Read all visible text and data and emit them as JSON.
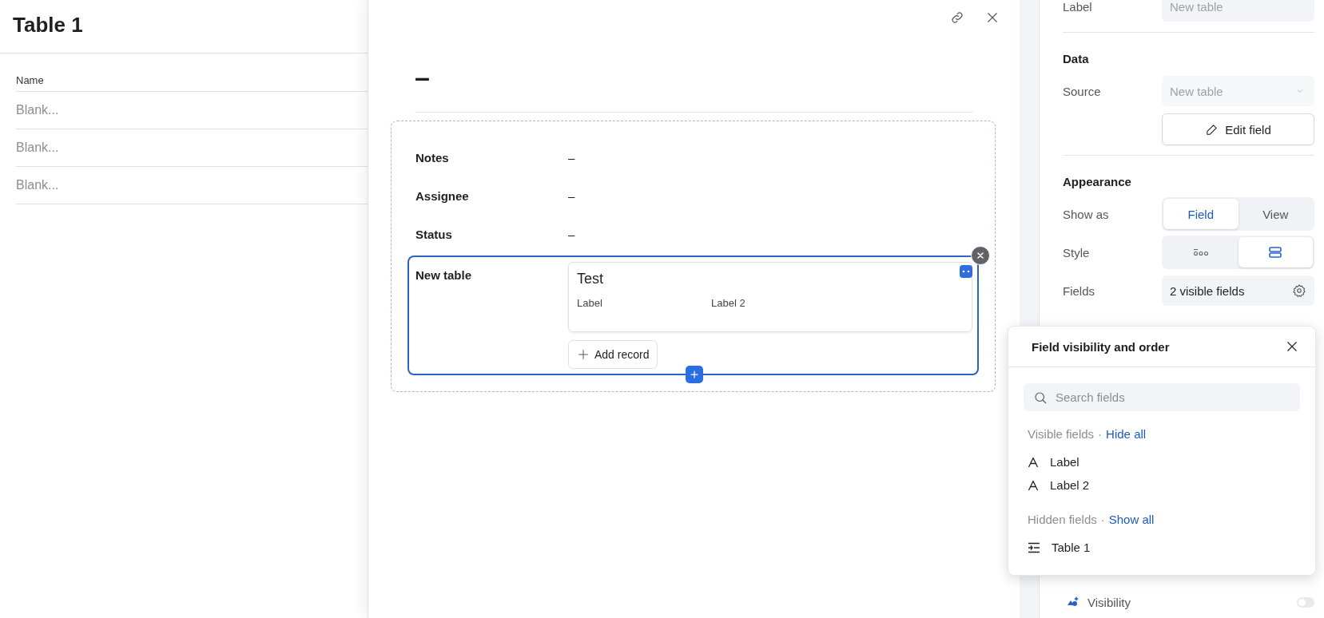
{
  "table_view": {
    "title": "Table 1",
    "columns": [
      "Name"
    ],
    "rows": [
      {
        "placeholder": "Blank..."
      },
      {
        "placeholder": "Blank..."
      },
      {
        "placeholder": "Blank..."
      }
    ]
  },
  "record_panel": {
    "title": "–",
    "fields": [
      {
        "kind": "plain",
        "label": "Notes",
        "value": "–",
        "selected": false
      },
      {
        "kind": "plain",
        "label": "Assignee",
        "value": "–",
        "selected": false
      },
      {
        "kind": "plain",
        "label": "Status",
        "value": "–",
        "selected": false
      },
      {
        "kind": "linked",
        "label": "New table",
        "selected": true,
        "records": [
          {
            "title": "Test",
            "fields": [
              "Label",
              "Label 2"
            ]
          }
        ],
        "add_button": "Add record"
      }
    ]
  },
  "settings": {
    "label_row": {
      "label": "Label",
      "placeholder": "New table"
    },
    "data": {
      "heading": "Data",
      "source": {
        "label": "Source",
        "value": "New table",
        "disabled": true
      },
      "edit_button": "Edit field"
    },
    "appearance": {
      "heading": "Appearance",
      "show_as": {
        "label": "Show as",
        "options": [
          {
            "label": "Field",
            "selected": true
          },
          {
            "label": "View",
            "selected": false
          }
        ]
      },
      "style": {
        "label": "Style",
        "options": [
          {
            "kind": "list",
            "selected": false
          },
          {
            "kind": "cards",
            "selected": true
          }
        ]
      },
      "fields": {
        "label": "Fields",
        "value": "2 visible fields"
      }
    },
    "visibility": {
      "label": "Visibility",
      "on": false
    }
  },
  "field_popup": {
    "title": "Field visibility and order",
    "search": {
      "placeholder": "Search fields"
    },
    "groups": [
      {
        "heading": "Visible fields",
        "separator": "·",
        "action": "Hide all",
        "items": [
          {
            "kind": "text",
            "label": "Label"
          },
          {
            "kind": "text",
            "label": "Label 2"
          }
        ]
      },
      {
        "heading": "Hidden fields",
        "separator": "·",
        "action": "Show all",
        "items": [
          {
            "kind": "lookup",
            "label": "Table 1"
          }
        ]
      }
    ]
  }
}
